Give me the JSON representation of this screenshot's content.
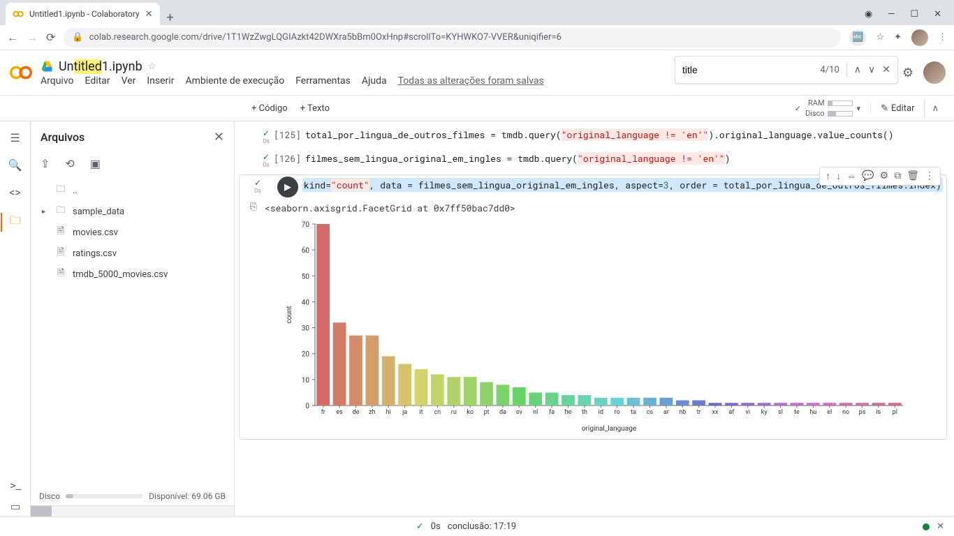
{
  "browser": {
    "tab_title": "Untitled1.ipynb - Colaboratory",
    "url": "colab.research.google.com/drive/1T1WzZwgLQGIAzkt42DWXra5bBm0OxHnp#scrollTo=KYHWKO7-VVER&uniqifier=6"
  },
  "doc": {
    "title_pre": "Un",
    "title_hl": "titled",
    "title_post": "1.ipynb"
  },
  "menu": {
    "arquivo": "Arquivo",
    "editar": "Editar",
    "ver": "Ver",
    "inserir": "Inserir",
    "ambiente": "Ambiente de execução",
    "ferramentas": "Ferramentas",
    "ajuda": "Ajuda",
    "saved": "Todas as alterações foram salvas"
  },
  "find": {
    "value": "title",
    "count": "4/10"
  },
  "toolbar": {
    "code": "+ Código",
    "text": "+ Texto",
    "ram": "RAM",
    "disk": "Disco",
    "edit": "Editar"
  },
  "files": {
    "title": "Arquivos",
    "parent": "..",
    "sample": "sample_data",
    "f1": "movies.csv",
    "f2": "ratings.csv",
    "f3": "tmdb_5000_movies.csv",
    "disk_label": "Disco",
    "disk_avail": "Disponível: 69.06 GB"
  },
  "cells": {
    "c1_prompt": "[125]",
    "c1_a": "total_por_lingua_de_outros_filmes = tmdb.query(",
    "c1_str": "\"original_language != 'en'\"",
    "c1_b": ").original_language.value_counts()",
    "c2_prompt": "[126]",
    "c2_a": "filmes_sem_lingua_original_em_ingles = tmdb.query(",
    "c2_str": "\"original_language != 'en'\"",
    "c2_b": ")",
    "c3_a": "kind=",
    "c3_str1": "\"count\"",
    "c3_b": ", data = filmes_sem_lingua_original_em_ingles, aspect=",
    "c3_num": "3",
    "c3_c": ", order = total_por_lingua_de_outros_filmes.index)",
    "output": "<seaborn.axisgrid.FacetGrid at 0x7ff50bac7dd0>",
    "zero_s": "0s"
  },
  "chart_data": {
    "type": "bar",
    "title": "",
    "xlabel": "original_language",
    "ylabel": "count",
    "ylim": [
      0,
      70
    ],
    "yticks": [
      0,
      10,
      20,
      30,
      40,
      50,
      60,
      70
    ],
    "categories": [
      "fr",
      "es",
      "de",
      "zh",
      "hi",
      "ja",
      "it",
      "cn",
      "ru",
      "ko",
      "pt",
      "da",
      "sv",
      "nl",
      "fa",
      "he",
      "th",
      "id",
      "ro",
      "ta",
      "cs",
      "ar",
      "nb",
      "tr",
      "xx",
      "af",
      "vi",
      "ky",
      "sl",
      "te",
      "hu",
      "el",
      "no",
      "ps",
      "is",
      "pl"
    ],
    "values": [
      70,
      32,
      27,
      27,
      19,
      16,
      14,
      12,
      11,
      11,
      9,
      8,
      7,
      5,
      5,
      4,
      4,
      3,
      3,
      3,
      3,
      3,
      2,
      2,
      1,
      1,
      1,
      1,
      1,
      1,
      1,
      1,
      1,
      1,
      1,
      1
    ]
  },
  "status": {
    "time": "0s",
    "msg": "conclusão: 17:19"
  }
}
